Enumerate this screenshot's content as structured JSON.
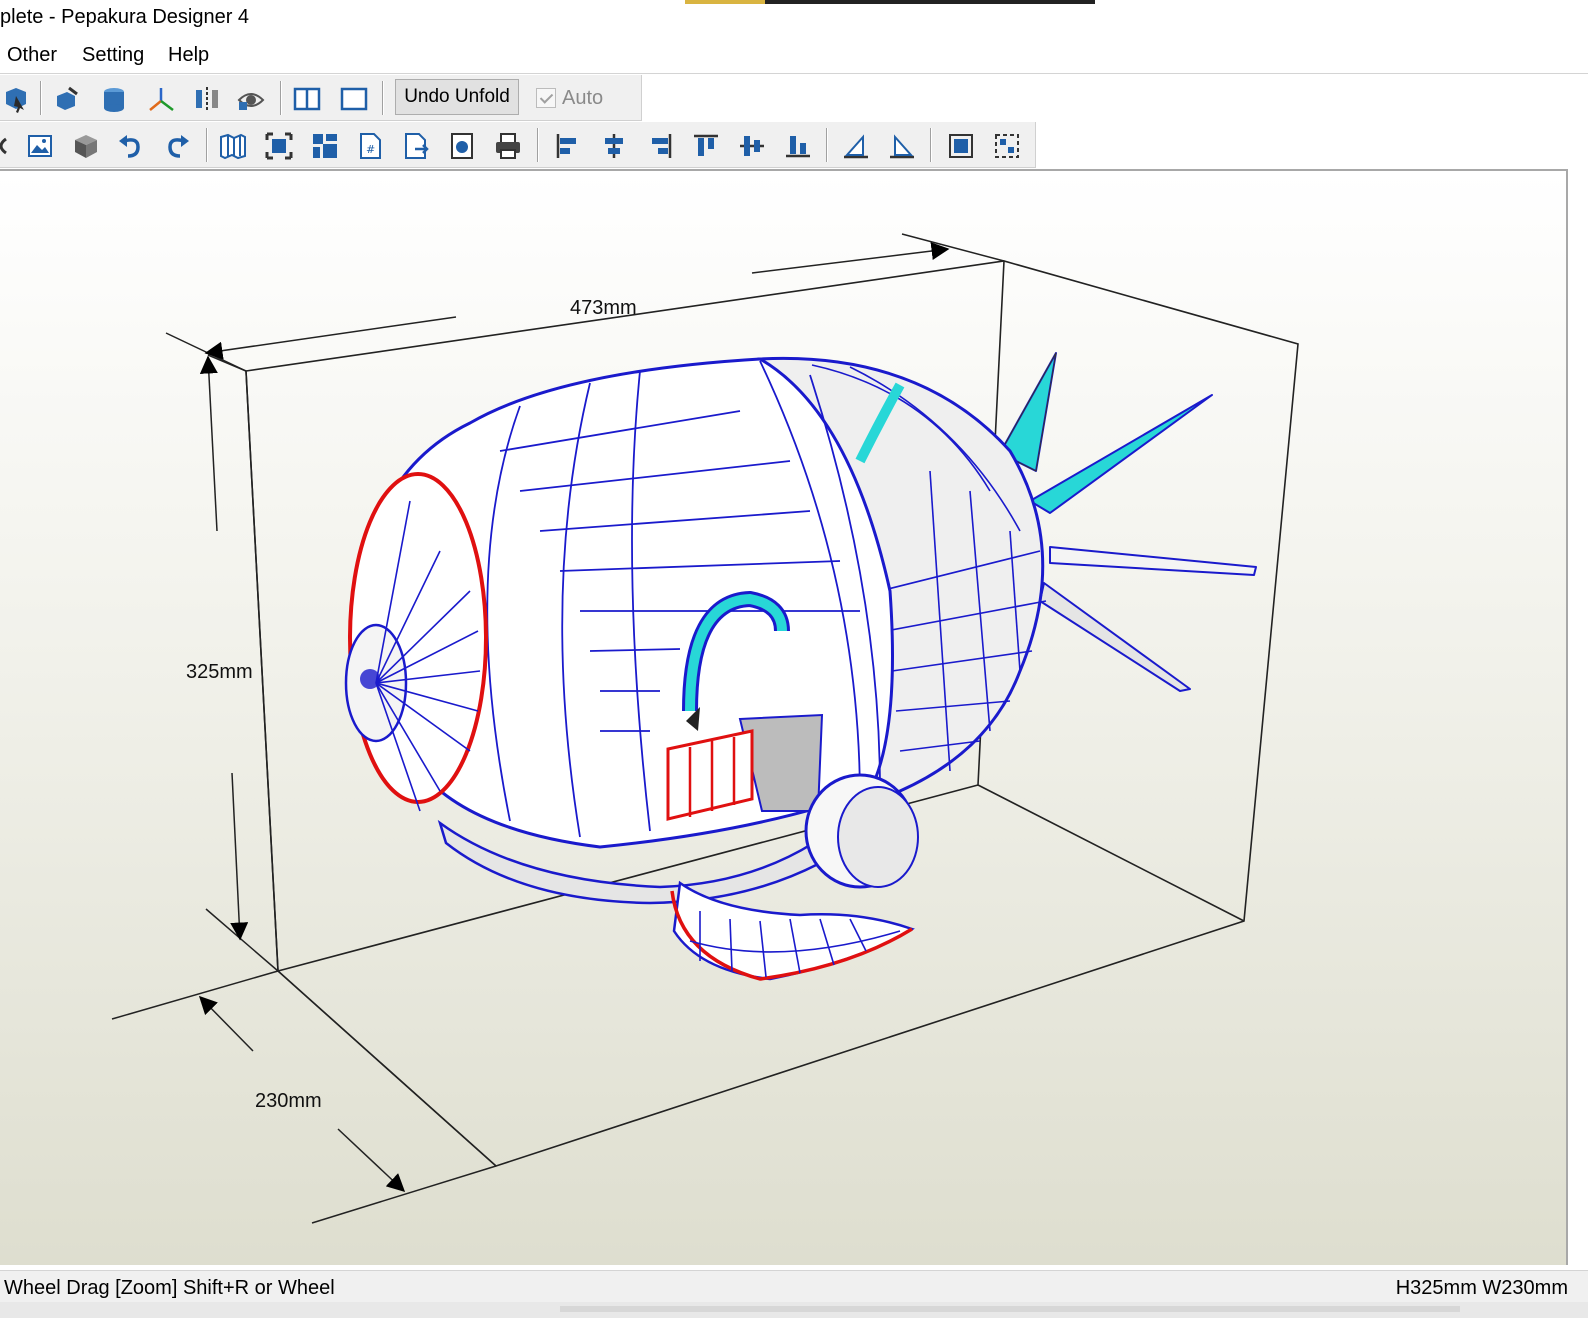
{
  "window": {
    "title": "plete - Pepakura Designer 4"
  },
  "menu": {
    "items": [
      "Other",
      "Setting",
      "Help"
    ]
  },
  "toolbar1": {
    "undo_unfold_label": "Undo Unfold",
    "auto_label": "Auto",
    "auto_checked": true,
    "icons": [
      "select-cursor-icon",
      "paint-bucket-icon",
      "cylinder-icon",
      "axis-icon",
      "mirror-icon",
      "visibility-eye-icon",
      "split-view-icon",
      "single-view-icon"
    ]
  },
  "toolbar2": {
    "icons": [
      "partial-icon",
      "texture-image-icon",
      "box-icon",
      "undo-icon",
      "redo-icon",
      "unfold-map-icon",
      "fit-view-icon",
      "arrange-icon",
      "page-number-icon",
      "page-export-icon",
      "snapshot-icon",
      "print-icon",
      "align-left-icon",
      "align-center-horizontal-icon",
      "align-right-icon",
      "align-top-icon",
      "align-middle-vertical-icon",
      "align-bottom-icon",
      "flip-left-icon",
      "flip-right-icon",
      "group-icon",
      "ungroup-icon"
    ]
  },
  "viewport": {
    "dimensions": {
      "width": "473mm",
      "height": "325mm",
      "depth": "230mm"
    },
    "colors": {
      "edge_blue": "#1a1acc",
      "cut_red": "#e01010",
      "accent_cyan": "#28d7d7",
      "face_white": "#ffffff",
      "face_grey": "#cfcfcf"
    }
  },
  "status": {
    "hint": "Wheel Drag [Zoom] Shift+R or Wheel",
    "size": "H325mm W230mm"
  }
}
